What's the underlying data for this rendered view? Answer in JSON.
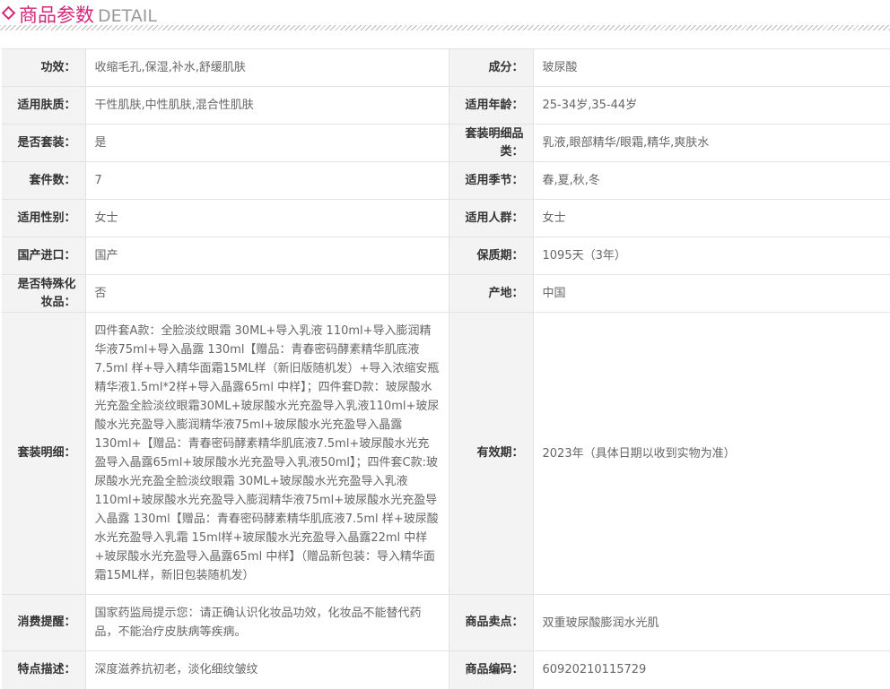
{
  "header": {
    "title_cn": "商品参数",
    "title_en": "DETAIL",
    "accent": "#d6267a"
  },
  "rows": [
    {
      "k1": "功效：",
      "v1": "收缩毛孔,保湿,补水,舒缓肌肤",
      "k2": "成分：",
      "v2": "玻尿酸"
    },
    {
      "k1": "适用肤质：",
      "v1": "干性肌肤,中性肌肤,混合性肌肤",
      "k2": "适用年龄：",
      "v2": "25-34岁,35-44岁"
    },
    {
      "k1": "是否套装：",
      "v1": "是",
      "k2": "套装明细品类：",
      "v2": "乳液,眼部精华/眼霜,精华,爽肤水"
    },
    {
      "k1": "套件数：",
      "v1": "7",
      "k2": "适用季节：",
      "v2": "春,夏,秋,冬"
    },
    {
      "k1": "适用性别：",
      "v1": "女士",
      "k2": "适用人群：",
      "v2": "女士"
    },
    {
      "k1": "国产进口：",
      "v1": "国产",
      "k2": "保质期：",
      "v2": "1095天（3年）"
    },
    {
      "k1": "是否特殊化妆品：",
      "v1": "否",
      "k2": "产地：",
      "v2": "中国"
    },
    {
      "k1": "套装明细：",
      "v1": "四件套A款：全脸淡纹眼霜 30ML+导入乳液 110ml+导入膨润精华液75ml+导入晶露 130ml【赠品：青春密码酵素精华肌底液 7.5ml 样+导入精华面霜15ML样（新旧版随机发）+导入浓缩安瓶精华液1.5ml*2样+导入晶露65ml 中样】；四件套D款：玻尿酸水光充盈全脸淡纹眼霜30ML+玻尿酸水光充盈导入乳液110ml+玻尿酸水光充盈导入膨润精华液75ml+玻尿酸水光充盈导入晶露130ml+【赠品：青春密码酵素精华肌底液7.5ml+玻尿酸水光充盈导入晶露65ml+玻尿酸水光充盈导入乳液50ml】；四件套C款:玻尿酸水光充盈全脸淡纹眼霜 30ML+玻尿酸水光充盈导入乳液 110ml+玻尿酸水光充盈导入膨润精华液75ml+玻尿酸水光充盈导入晶露 130ml【赠品：青春密码酵素精华肌底液7.5ml 样+玻尿酸水光充盈导入乳霜 15ml样+玻尿酸水光充盈导入晶露22ml 中样+玻尿酸水光充盈导入晶露65ml 中样】（赠品新包装：导入精华面霜15ML样，新旧包装随机发）",
      "k2": "有效期：",
      "v2": "2023年（具体日期以收到实物为准）"
    },
    {
      "k1": "消费提醒：",
      "v1": "国家药监局提示您：请正确认识化妆品功效，化妆品不能替代药品，不能治疗皮肤病等疾病。",
      "k2": "商品卖点：",
      "v2": "双重玻尿酸膨润水光肌"
    },
    {
      "k1": "特点描述：",
      "v1": "深度滋养抗初老，淡化细纹皱纹",
      "k2": "商品编码：",
      "v2": "60920210115729"
    }
  ]
}
